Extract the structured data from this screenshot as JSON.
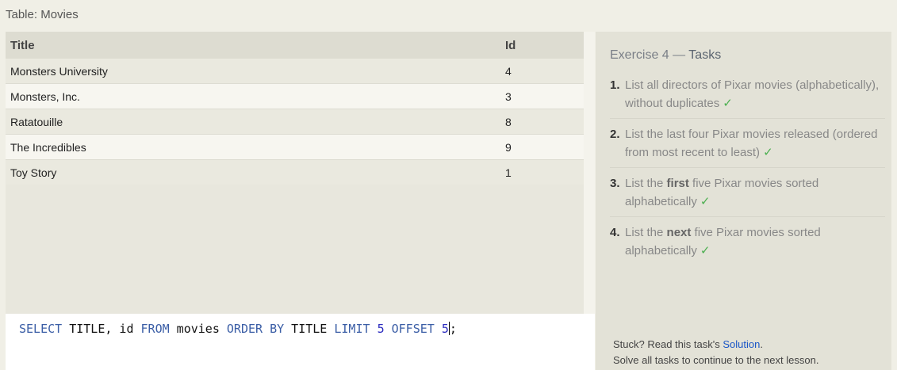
{
  "table": {
    "caption": "Table: Movies",
    "columns": [
      "Title",
      "Id"
    ],
    "rows": [
      {
        "title": "Monsters University",
        "id": "4"
      },
      {
        "title": "Monsters, Inc.",
        "id": "3"
      },
      {
        "title": "Ratatouille",
        "id": "8"
      },
      {
        "title": "The Incredibles",
        "id": "9"
      },
      {
        "title": "Toy Story",
        "id": "1"
      }
    ]
  },
  "query": {
    "select": "SELECT",
    "cols": " TITLE, id ",
    "from": "FROM",
    "table": " movies ",
    "order": "ORDER BY",
    "ordercol": " TITLE ",
    "limit": "LIMIT",
    "limit_val": "5",
    "offset": "OFFSET",
    "offset_val": "5",
    "end": ";"
  },
  "exercise": {
    "title_prefix": "Exercise 4 — ",
    "title_tasks": "Tasks",
    "tasks": [
      {
        "num": "1.",
        "pre": "List all directors of Pixar movies (alphabetically), without duplicates",
        "bold": "",
        "post": "",
        "check": "✓"
      },
      {
        "num": "2.",
        "pre": "List the last four Pixar movies released (ordered from most recent to least)",
        "bold": "",
        "post": "",
        "check": "✓"
      },
      {
        "num": "3.",
        "pre": "List the ",
        "bold": "first",
        "post": " five Pixar movies sorted alphabetically",
        "check": "✓"
      },
      {
        "num": "4.",
        "pre": "List the ",
        "bold": "next",
        "post": " five Pixar movies sorted alphabetically",
        "check": "✓"
      }
    ]
  },
  "footer": {
    "stuck_pre": "Stuck? Read this task's ",
    "solution_link": "Solution",
    "stuck_post": ".",
    "line2": "Solve all tasks to continue to the next lesson."
  },
  "colors": {
    "keyword": "#3b5ea6",
    "check": "#4caf50",
    "link": "#1a56c7"
  }
}
